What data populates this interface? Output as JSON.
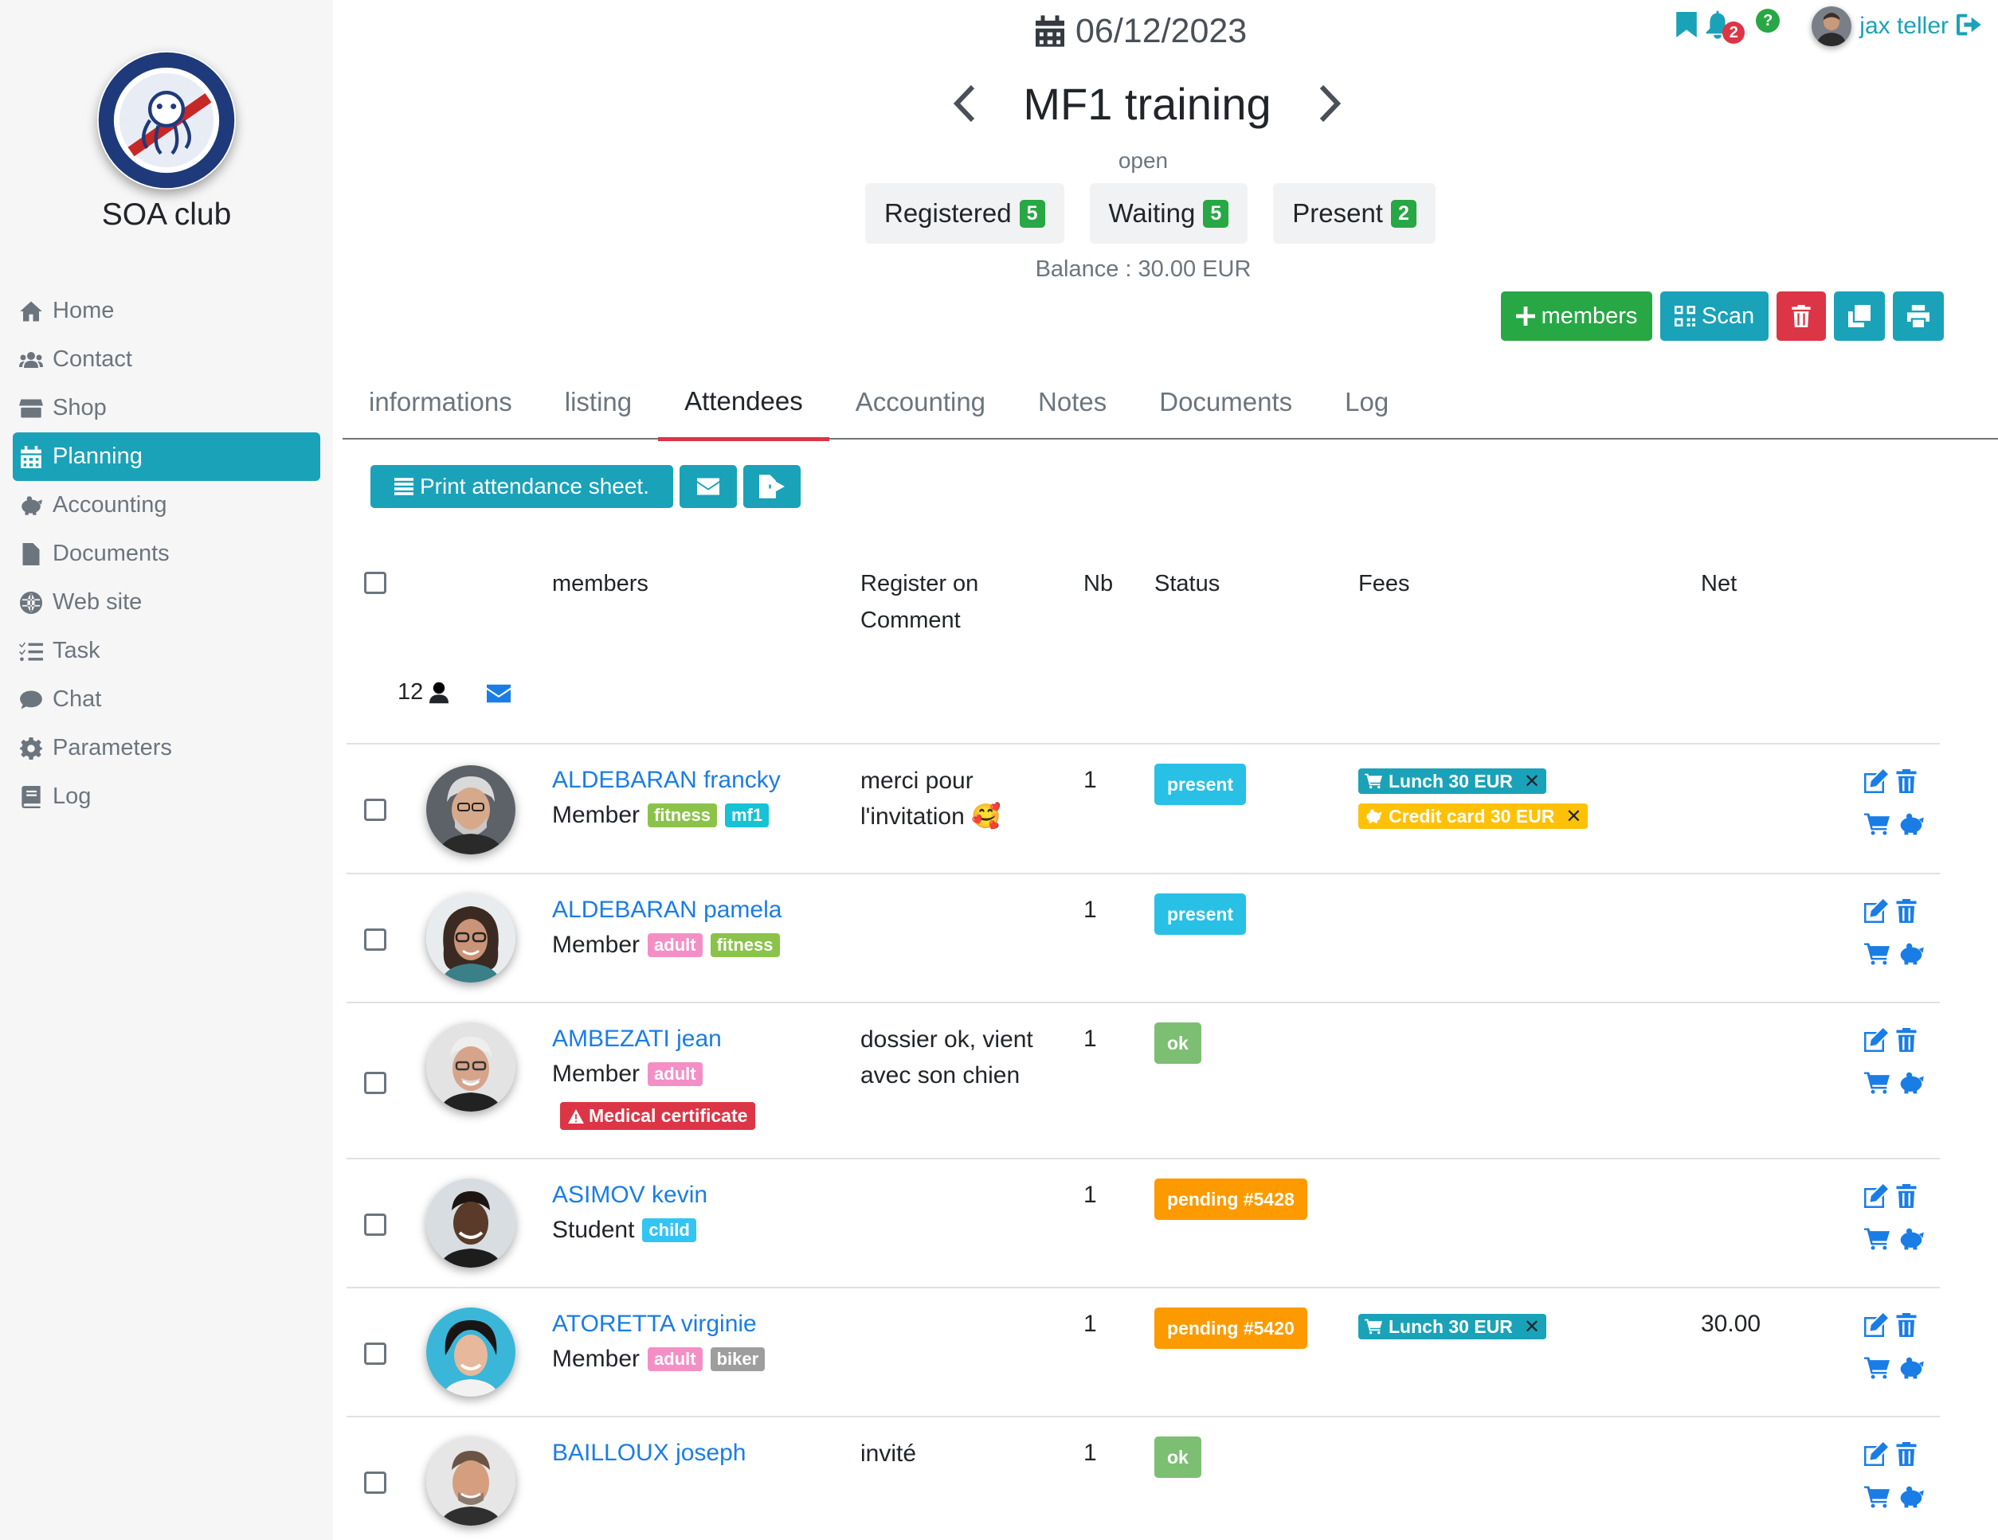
{
  "sidebar": {
    "club_name": "SOA club",
    "items": [
      {
        "label": "Home",
        "icon": "home-icon"
      },
      {
        "label": "Contact",
        "icon": "users-icon"
      },
      {
        "label": "Shop",
        "icon": "shop-icon"
      },
      {
        "label": "Planning",
        "icon": "calendar-icon",
        "active": true
      },
      {
        "label": "Accounting",
        "icon": "piggy-bank-icon"
      },
      {
        "label": "Documents",
        "icon": "file-icon"
      },
      {
        "label": "Web site",
        "icon": "globe-icon"
      },
      {
        "label": "Task",
        "icon": "tasks-icon"
      },
      {
        "label": "Chat",
        "icon": "chat-icon"
      },
      {
        "label": "Parameters",
        "icon": "gear-icon"
      },
      {
        "label": "Log",
        "icon": "book-icon"
      }
    ]
  },
  "header": {
    "date": "06/12/2023",
    "title": "MF1 training",
    "status": "open",
    "counters": [
      {
        "label": "Registered",
        "count": "5"
      },
      {
        "label": "Waiting",
        "count": "5"
      },
      {
        "label": "Present",
        "count": "2"
      }
    ],
    "balance": "Balance : 30.00 EUR"
  },
  "topbar": {
    "notification_count": "2",
    "help": "?",
    "user_name": "jax teller"
  },
  "actions": {
    "add_members": "members",
    "scan": "Scan"
  },
  "tabs": [
    "informations",
    "listing",
    "Attendees",
    "Accounting",
    "Notes",
    "Documents",
    "Log"
  ],
  "active_tab": "Attendees",
  "toolbar": {
    "print": "Print attendance sheet."
  },
  "table": {
    "headers": {
      "members": "members",
      "register_on": "Register on",
      "comment": "Comment",
      "nb": "Nb",
      "status": "Status",
      "fees": "Fees",
      "net": "Net"
    },
    "total_count": "12",
    "rows": [
      {
        "name": "ALDEBARAN francky",
        "role": "Member",
        "tags": [
          {
            "label": "fitness",
            "kind": "fitness"
          },
          {
            "label": "mf1",
            "kind": "mf1"
          }
        ],
        "comment": "merci pour l'invitation 🥰",
        "nb": "1",
        "status": "present",
        "status_kind": "present",
        "fees": [
          {
            "label": "Lunch 30 EUR",
            "kind": "lunch"
          },
          {
            "label": "Credit card 30 EUR",
            "kind": "cc"
          }
        ],
        "net": ""
      },
      {
        "name": "ALDEBARAN pamela",
        "role": "Member",
        "tags": [
          {
            "label": "adult",
            "kind": "adult"
          },
          {
            "label": "fitness",
            "kind": "fitness"
          }
        ],
        "comment": "",
        "nb": "1",
        "status": "present",
        "status_kind": "present",
        "fees": [],
        "net": ""
      },
      {
        "name": "AMBEZATI jean",
        "role": "Member",
        "tags": [
          {
            "label": "adult",
            "kind": "adult"
          }
        ],
        "warning": "Medical certificate",
        "comment": "dossier ok, vient avec son chien",
        "nb": "1",
        "status": "ok",
        "status_kind": "ok",
        "fees": [],
        "net": ""
      },
      {
        "name": "ASIMOV kevin",
        "role": "Student",
        "tags": [
          {
            "label": "child",
            "kind": "child"
          }
        ],
        "comment": "",
        "nb": "1",
        "status": "pending #5428",
        "status_kind": "pending",
        "fees": [],
        "net": ""
      },
      {
        "name": "ATORETTA virginie",
        "role": "Member",
        "tags": [
          {
            "label": "adult",
            "kind": "adult"
          },
          {
            "label": "biker",
            "kind": "biker"
          }
        ],
        "comment": "",
        "nb": "1",
        "status": "pending #5420",
        "status_kind": "pending",
        "fees": [
          {
            "label": "Lunch 30 EUR",
            "kind": "lunch"
          }
        ],
        "net": "30.00"
      },
      {
        "name": "BAILLOUX joseph",
        "role": "",
        "tags": [],
        "comment": "invité",
        "nb": "1",
        "status": "ok",
        "status_kind": "ok",
        "fees": [],
        "net": ""
      }
    ]
  },
  "colors": {
    "accent": "#1aa2b8",
    "success": "#28a745",
    "danger": "#dc3545",
    "link": "#1a7de6",
    "warning": "#ffc107",
    "pending": "#fd9a00"
  }
}
